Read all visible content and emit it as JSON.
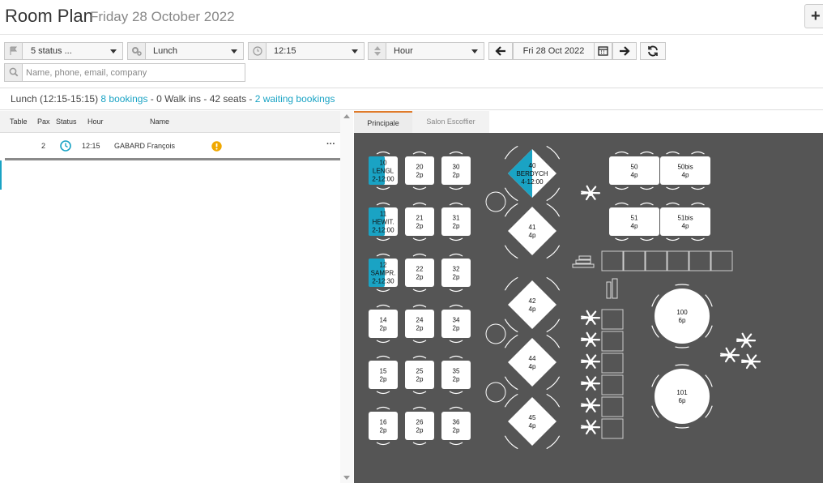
{
  "header": {
    "title": "Room Plan",
    "date": "Friday 28 October 2022",
    "add_label": "+"
  },
  "toolbar": {
    "status_filter": "5 status ...",
    "service": "Lunch",
    "time": "12:15",
    "interval": "Hour",
    "date": "Fri 28 Oct 2022",
    "search_placeholder": "Name, phone, email, company"
  },
  "summary": {
    "service": "Lunch (12:15-15:15)",
    "bookings_link": "8 bookings",
    "walkins": " - 0 Walk ins - 42 seats - ",
    "waiting_link": "2 waiting bookings"
  },
  "list": {
    "columns": [
      "Table",
      "Pax",
      "Status",
      "Hour",
      "Name"
    ],
    "rows": [
      {
        "pax": "2",
        "hour": "12:15",
        "name": "GABARD François",
        "more": "···"
      }
    ]
  },
  "tabs": [
    "Principale",
    "Salon Escoffier"
  ],
  "colors": {
    "accent": "#1aa3c4",
    "floor": "#555555",
    "warning": "#f0a800"
  },
  "floor_tables": [
    {
      "num": "10",
      "sub": "LENGL",
      "cover": "2-12:00",
      "booked": true
    },
    {
      "num": "11",
      "sub": "HEWIT.",
      "cover": "2-12:00",
      "booked": true
    },
    {
      "num": "12",
      "sub": "SAMPR.",
      "cover": "2-12:30",
      "booked": true
    },
    {
      "num": "14",
      "cover": "2p"
    },
    {
      "num": "15",
      "cover": "2p"
    },
    {
      "num": "16",
      "cover": "2p"
    },
    {
      "num": "20",
      "cover": "2p"
    },
    {
      "num": "21",
      "cover": "2p"
    },
    {
      "num": "22",
      "cover": "2p"
    },
    {
      "num": "24",
      "cover": "2p"
    },
    {
      "num": "25",
      "cover": "2p"
    },
    {
      "num": "26",
      "cover": "2p"
    },
    {
      "num": "30",
      "cover": "2p"
    },
    {
      "num": "31",
      "cover": "2p"
    },
    {
      "num": "32",
      "cover": "2p"
    },
    {
      "num": "34",
      "cover": "2p"
    },
    {
      "num": "35",
      "cover": "2p"
    },
    {
      "num": "36",
      "cover": "2p"
    },
    {
      "num": "40",
      "sub": "BERDYCH",
      "cover": "4-12:00",
      "booked": true
    },
    {
      "num": "41",
      "cover": "4p"
    },
    {
      "num": "42",
      "cover": "4p"
    },
    {
      "num": "44",
      "cover": "4p"
    },
    {
      "num": "45",
      "cover": "4p"
    },
    {
      "num": "50",
      "cover": "4p"
    },
    {
      "num": "50bis",
      "cover": "4p"
    },
    {
      "num": "51",
      "cover": "4p"
    },
    {
      "num": "51bis",
      "cover": "4p"
    },
    {
      "num": "100",
      "cover": "6p"
    },
    {
      "num": "101",
      "cover": "6p"
    }
  ]
}
